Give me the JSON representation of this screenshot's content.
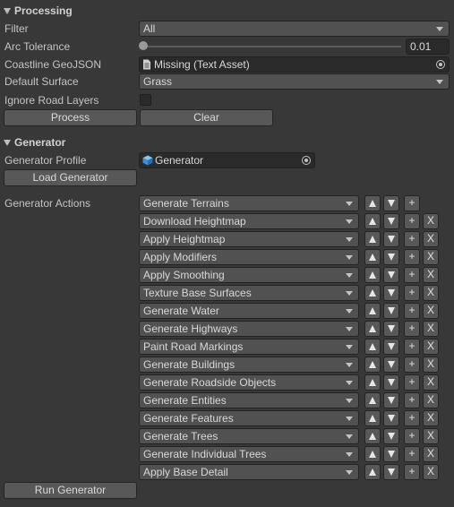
{
  "processing": {
    "header": "Processing",
    "filter_label": "Filter",
    "filter_value": "All",
    "arc_label": "Arc Tolerance",
    "arc_value": "0.01",
    "arc_level": 0,
    "coastline_label": "Coastline GeoJSON",
    "coastline_value": "Missing (Text Asset)",
    "surface_label": "Default Surface",
    "surface_value": "Grass",
    "ignore_label": "Ignore Road Layers",
    "ignore_checked": false,
    "process_btn": "Process",
    "clear_btn": "Clear"
  },
  "generator": {
    "header": "Generator",
    "profile_label": "Generator Profile",
    "profile_value": "Generator",
    "load_btn": "Load Generator",
    "actions_label": "Generator Actions",
    "add_symbol": "+",
    "remove_symbol": "X",
    "actions": [
      "Generate Terrains",
      "Download Heightmap",
      "Apply Heightmap",
      "Apply Modifiers",
      "Apply Smoothing",
      "Texture Base Surfaces",
      "Generate Water",
      "Generate Highways",
      "Paint Road Markings",
      "Generate Buildings",
      "Generate Roadside Objects",
      "Generate Entities",
      "Generate Features",
      "Generate Trees",
      "Generate Individual Trees",
      "Apply Base Detail"
    ],
    "run_btn": "Run Generator"
  }
}
